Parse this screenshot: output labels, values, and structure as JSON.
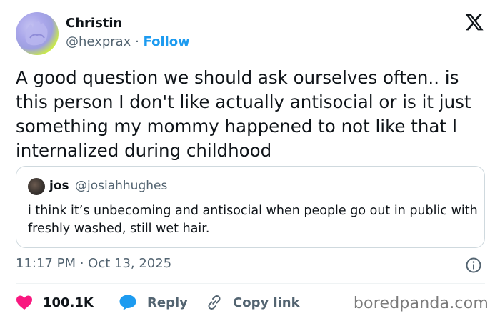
{
  "author": {
    "name": "Christin",
    "handle": "@hexprax",
    "separator": "·",
    "follow_label": "Follow"
  },
  "tweet": {
    "text": "A good question we should ask ourselves often.. is this person I don't like actually antisocial or is it just something my mommy happened to not like that I internalized during childhood"
  },
  "quote": {
    "name": "jos",
    "handle": "@josiahhughes",
    "text": "i think it’s unbecoming and antisocial when people go out in public with freshly washed, still wet hair."
  },
  "meta": {
    "timestamp": "11:17 PM · Oct 13, 2025"
  },
  "actions": {
    "likes": "100.1K",
    "reply_label": "Reply",
    "copy_label": "Copy link"
  },
  "watermark": "boredpanda.com",
  "colors": {
    "like": "#f91880",
    "reply": "#1d9bf0",
    "link": "#1d9bf0",
    "secondary_text": "#536471"
  },
  "icons": {
    "platform": "x-logo-icon",
    "like": "heart-icon",
    "reply": "reply-bubble-icon",
    "copy": "link-icon",
    "info": "info-icon"
  }
}
